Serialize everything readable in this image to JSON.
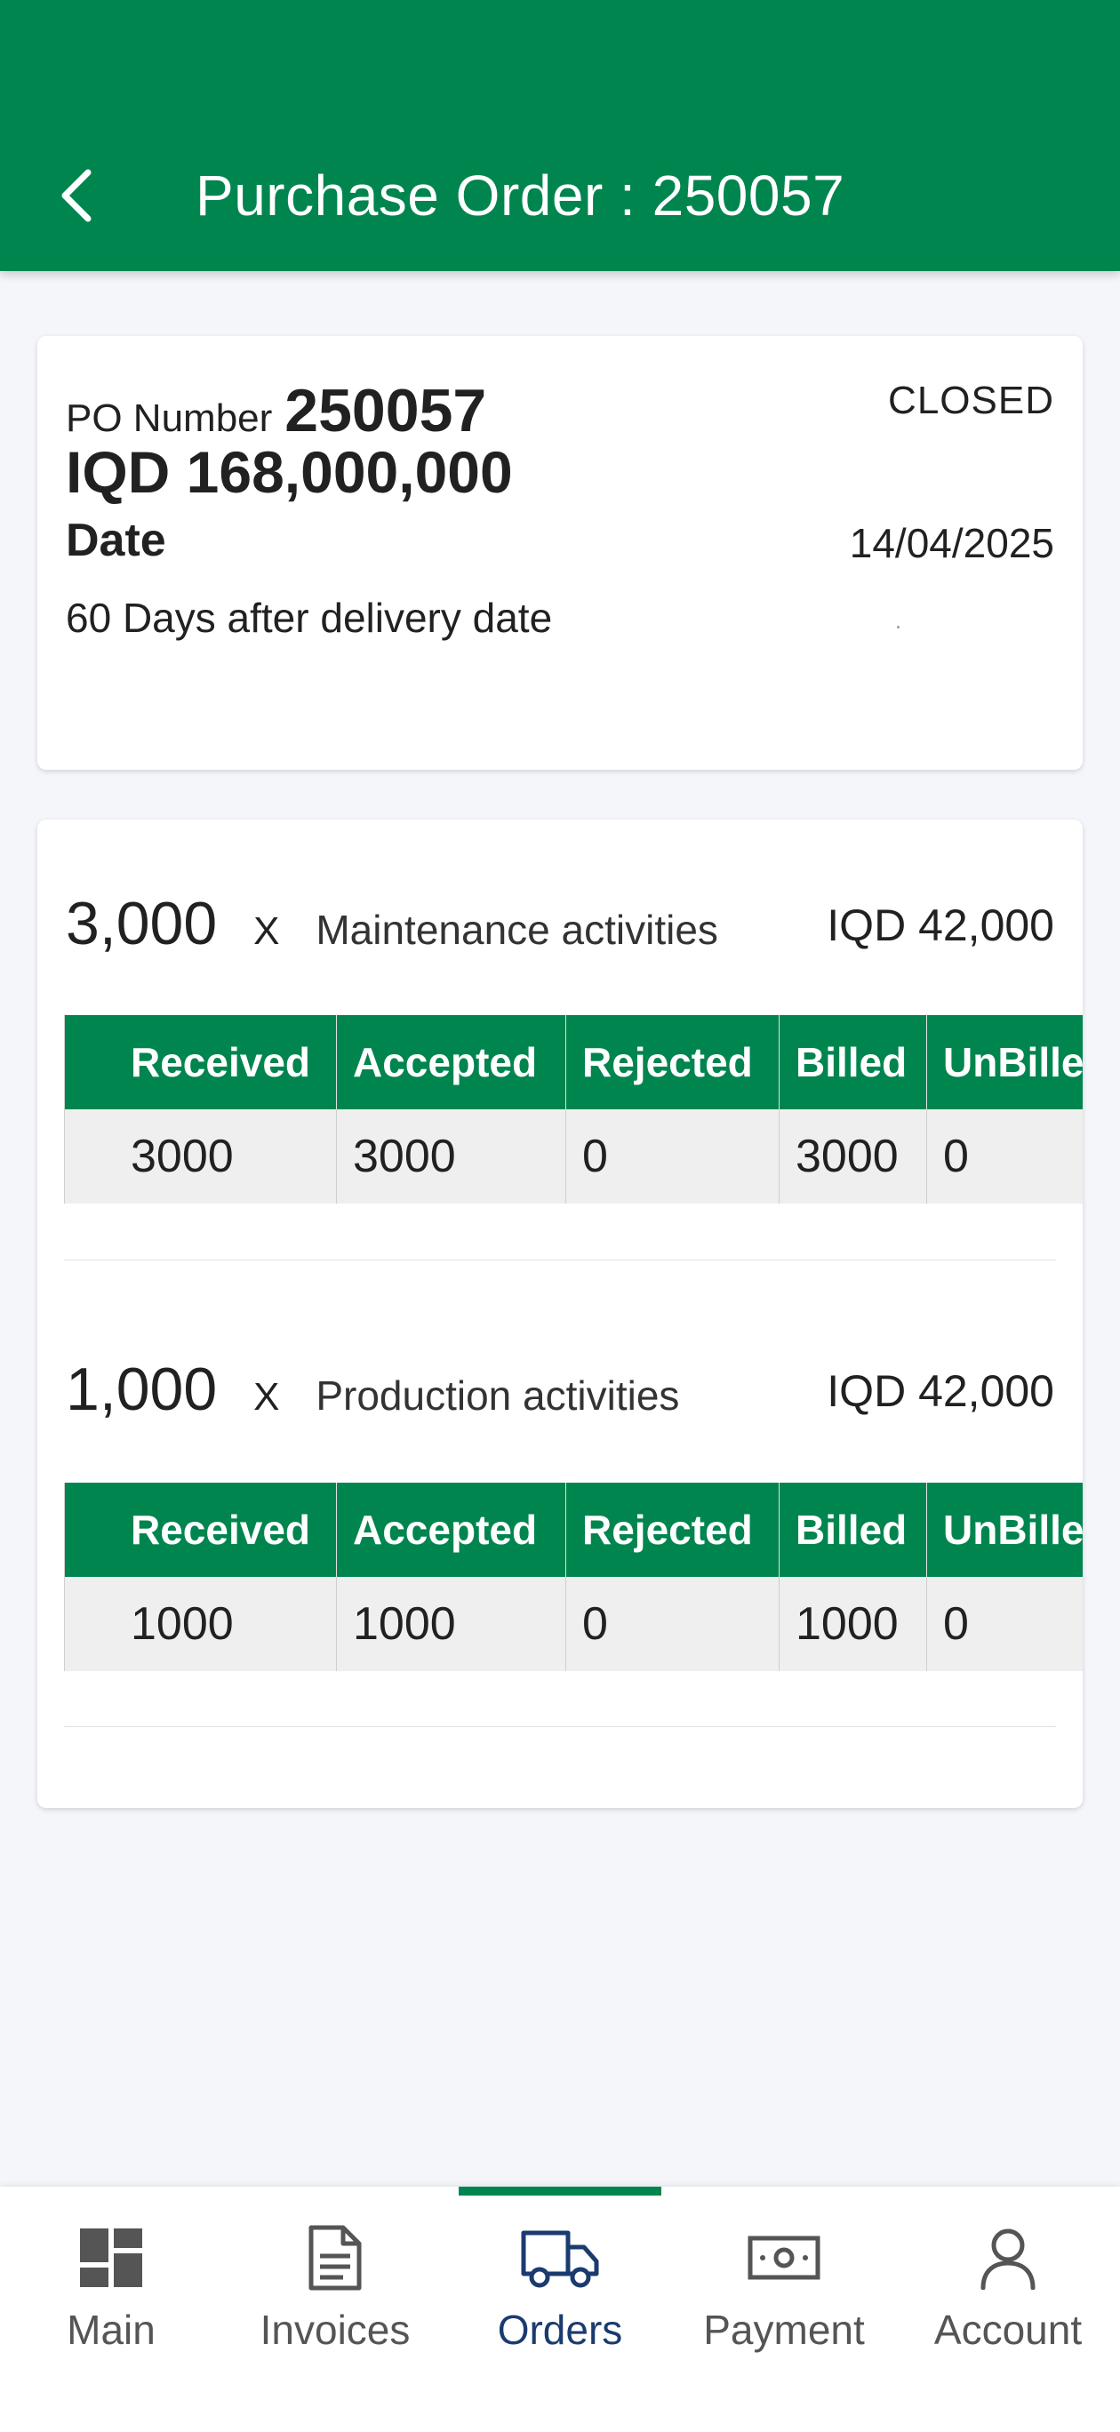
{
  "appbar": {
    "title": "Purchase Order : 250057"
  },
  "summary": {
    "po_label": "PO Number",
    "po_number": "250057",
    "status": "CLOSED",
    "amount": "IQD 168,000,000",
    "date_label": "Date",
    "date_value": "14/04/2025",
    "terms": "60 Days after delivery date"
  },
  "lines": [
    {
      "qty": "3,000",
      "x": "X",
      "description": "Maintenance activities",
      "price": "IQD 42,000",
      "headers": [
        "Received",
        "Accepted",
        "Rejected",
        "Billed",
        "UnBilled"
      ],
      "values": [
        "3000",
        "3000",
        "0",
        "3000",
        "0"
      ]
    },
    {
      "qty": "1,000",
      "x": "X",
      "description": "Production activities",
      "price": "IQD 42,000",
      "headers": [
        "Received",
        "Accepted",
        "Rejected",
        "Billed",
        "UnBilled"
      ],
      "values": [
        "1000",
        "1000",
        "0",
        "1000",
        "0"
      ]
    }
  ],
  "nav": {
    "items": [
      {
        "label": "Main",
        "icon": "dashboard-icon"
      },
      {
        "label": "Invoices",
        "icon": "document-icon"
      },
      {
        "label": "Orders",
        "icon": "truck-icon",
        "active": true
      },
      {
        "label": "Payment",
        "icon": "banknote-icon"
      },
      {
        "label": "Account",
        "icon": "person-icon"
      }
    ]
  },
  "colors": {
    "primary": "#00854f",
    "active_nav": "#1b3b6f"
  }
}
